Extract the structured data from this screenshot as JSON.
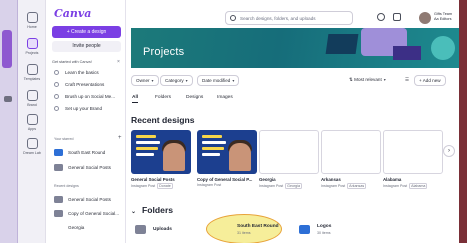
{
  "app": {
    "logo": "Canva"
  },
  "rail": {
    "items": [
      {
        "label": "Home",
        "icon": "home-icon"
      },
      {
        "label": "Projects",
        "icon": "folder-icon"
      },
      {
        "label": "Templates",
        "icon": "templates-icon"
      },
      {
        "label": "Brand",
        "icon": "brand-icon"
      },
      {
        "label": "Apps",
        "icon": "apps-icon"
      },
      {
        "label": "Dream Lab",
        "icon": "dream-lab-icon"
      }
    ]
  },
  "sidebar": {
    "create_label": "+ Create a design",
    "invite_label": "Invite people",
    "getting_started": {
      "heading": "Get started with Canva!",
      "close": "×",
      "items": [
        "Learn the basics",
        "Craft Presentations",
        "Brush up on Social Me...",
        "Set up your Brand"
      ]
    },
    "starred": {
      "heading": "Your starred",
      "add": "+",
      "items": [
        "South East Round",
        "General Social Posts"
      ]
    },
    "recent": {
      "heading": "Recent designs",
      "items": [
        "General Social Posts",
        "Copy of General Social...",
        "Georgia"
      ]
    }
  },
  "header": {
    "search_placeholder": "Search designs, folders, and uploads",
    "user_name": "Gifts Team",
    "user_sub": "Aa Editors"
  },
  "banner": {
    "title": "Projects"
  },
  "filters": {
    "owner": "Owner",
    "category": "Category",
    "date": "Date modified",
    "sort": "Most relevant",
    "add_new": "+ Add new"
  },
  "tabs": [
    "All",
    "Folders",
    "Designs",
    "Images"
  ],
  "recent": {
    "title": "Recent designs",
    "cards": [
      {
        "name": "General Social Posts",
        "meta": "Instagram Post",
        "tag": "Donate"
      },
      {
        "name": "Copy of General Social P...",
        "meta": "Instagram Post",
        "tag": ""
      },
      {
        "name": "Georgia",
        "meta": "Instagram Post",
        "tag": "Georgia"
      },
      {
        "name": "Arkansas",
        "meta": "Instagram Post",
        "tag": "Arkansas"
      },
      {
        "name": "Alabama",
        "meta": "Instagram Post",
        "tag": "Alabama"
      }
    ],
    "next": "›"
  },
  "folders": {
    "title": "Folders",
    "chevron": "⌄",
    "items": [
      {
        "name": "Uploads",
        "meta": "",
        "color": "#7e8296"
      },
      {
        "name": "South East Round",
        "meta": "31 items",
        "color": "#2d6fd6"
      },
      {
        "name": "Logos",
        "meta": "30 items",
        "color": "#2d6fd6"
      }
    ]
  },
  "colors": {
    "accent": "#7b3fe4",
    "banner": "#1c7a7a",
    "highlight": "#f6ee9a"
  }
}
